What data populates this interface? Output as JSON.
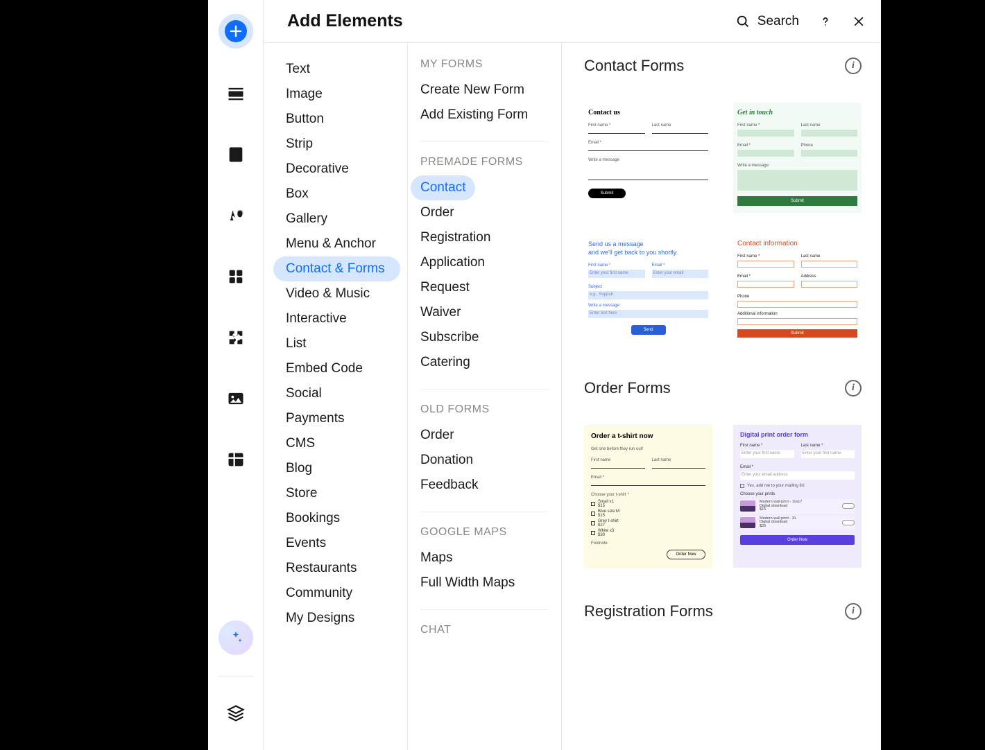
{
  "header": {
    "title": "Add Elements",
    "search_label": "Search"
  },
  "categories": [
    "Text",
    "Image",
    "Button",
    "Strip",
    "Decorative",
    "Box",
    "Gallery",
    "Menu & Anchor",
    "Contact & Forms",
    "Video & Music",
    "Interactive",
    "List",
    "Embed Code",
    "Social",
    "Payments",
    "CMS",
    "Blog",
    "Store",
    "Bookings",
    "Events",
    "Restaurants",
    "Community",
    "My Designs"
  ],
  "categories_active": "Contact & Forms",
  "subgroups": {
    "my_forms": {
      "label": "MY FORMS",
      "items": [
        "Create New Form",
        "Add Existing Form"
      ]
    },
    "premade": {
      "label": "PREMADE FORMS",
      "items": [
        "Contact",
        "Order",
        "Registration",
        "Application",
        "Request",
        "Waiver",
        "Subscribe",
        "Catering"
      ],
      "active": "Contact"
    },
    "old": {
      "label": "OLD FORMS",
      "items": [
        "Order",
        "Donation",
        "Feedback"
      ]
    },
    "maps": {
      "label": "GOOGLE MAPS",
      "items": [
        "Maps",
        "Full Width Maps"
      ]
    },
    "chat": {
      "label": "CHAT"
    }
  },
  "preview": {
    "sec1": "Contact Forms",
    "sec2": "Order Forms",
    "sec3": "Registration Forms",
    "t1": {
      "title": "Contact us",
      "first": "First name *",
      "last": "Last name",
      "email": "Email *",
      "msg": "Write a message",
      "btn": "Submit"
    },
    "t2": {
      "title": "Get in touch",
      "first": "First name *",
      "last": "Last name",
      "email": "Email *",
      "phone": "Phone",
      "msg": "Write a message",
      "btn": "Submit"
    },
    "t3": {
      "title": "Send us a message\nand we'll get back to you shortly.",
      "first": "First name *",
      "email": "Email *",
      "p1": "Enter your first name",
      "p2": "Enter your email",
      "subject": "Subject",
      "sp": "e.g., Support",
      "msg": "Write a message",
      "mp": "Enter text here",
      "btn": "Send"
    },
    "t4": {
      "title": "Contact information",
      "first": "First name *",
      "last": "Last name",
      "email": "Email *",
      "addr": "Address",
      "phone": "Phone",
      "addl": "Additional information",
      "btn": "Submit"
    },
    "t5": {
      "title": "Order a t-shirt now",
      "sub": "Get one before they run out!",
      "first": "First name",
      "last": "Last name",
      "email": "Email *",
      "choose": "Choose your t-shirt *",
      "o1a": "Small x1",
      "o1b": "$15",
      "o2a": "Blue size M",
      "o2b": "$15",
      "o3a": "Grey  t-shirt",
      "o3b": "$27",
      "o4a": "White x3",
      "o4b": "$30",
      "foot": "Footnote",
      "btn": "Order Now"
    },
    "t6": {
      "title": "Digital print order form",
      "first": "First name *",
      "last": "Last name *",
      "p1": "Enter your first name",
      "p2": "Enter your first name",
      "email": "Email *",
      "ep": "Enter your email address",
      "check": "Yes, add me to your mailing list",
      "choose": "Choose your prints",
      "r1a": "Modern wall print - 11x17",
      "r1b": "Digital download",
      "r1c": "$15",
      "r2a": "Modern wall print - XL",
      "r2b": "Digital download",
      "r2c": "$25",
      "btn": "Order Now"
    }
  }
}
